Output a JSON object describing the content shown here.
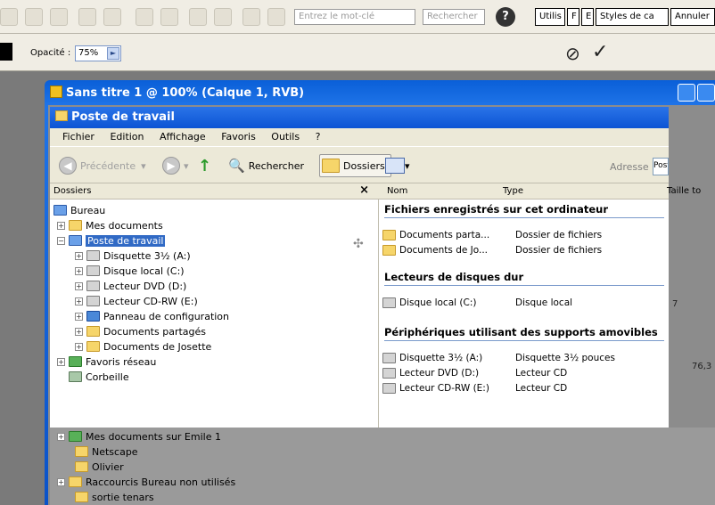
{
  "ps_toolbar": {
    "search_placeholder": "Entrez le mot-clé",
    "search_button": "Rechercher",
    "tabs": [
      "Utilis",
      "F",
      "E",
      "Styles de ca",
      "Annuler"
    ]
  },
  "ps_options": {
    "opacity_label": "Opacité :",
    "opacity_value": "75%",
    "cancel_symbol": "⊘",
    "commit_symbol": "✓"
  },
  "document": {
    "title": "Sans titre 1 @ 100% (Calque 1, RVB)"
  },
  "explorer": {
    "title": "Poste de travail",
    "menu": [
      "Fichier",
      "Edition",
      "Affichage",
      "Favoris",
      "Outils",
      "?"
    ],
    "toolbar": {
      "back": "Précédente",
      "search": "Rechercher",
      "folders": "Dossiers",
      "address_label": "Adresse",
      "address_value": "Poste de travail"
    },
    "left_header": "Dossiers",
    "left_close": "×",
    "columns": {
      "name": "Nom",
      "type": "Type",
      "size": "Taille to"
    },
    "tree": [
      {
        "label": "Bureau"
      },
      {
        "label": "Mes documents"
      },
      {
        "label": "Poste de travail"
      },
      {
        "label": "Disquette 3½ (A:)"
      },
      {
        "label": "Disque local (C:)"
      },
      {
        "label": "Lecteur DVD (D:)"
      },
      {
        "label": "Lecteur CD-RW (E:)"
      },
      {
        "label": "Panneau de configuration"
      },
      {
        "label": "Documents partagés"
      },
      {
        "label": "Documents de Josette"
      },
      {
        "label": "Favoris réseau"
      },
      {
        "label": "Corbeille"
      }
    ],
    "groups": [
      {
        "title": "Fichiers enregistrés sur cet ordinateur",
        "rows": [
          {
            "name": "Documents parta...",
            "type": "Dossier de fichiers"
          },
          {
            "name": "Documents de Jo...",
            "type": "Dossier de fichiers"
          }
        ]
      },
      {
        "title": "Lecteurs de disques dur",
        "rows": [
          {
            "name": "Disque local (C:)",
            "type": "Disque local"
          }
        ]
      },
      {
        "title": "Périphériques utilisant des supports amovibles",
        "rows": [
          {
            "name": "Disquette 3½ (A:)",
            "type": "Disquette 3½ pouces"
          },
          {
            "name": "Lecteur DVD (D:)",
            "type": "Lecteur CD"
          },
          {
            "name": "Lecteur CD-RW (E:)",
            "type": "Lecteur CD"
          }
        ]
      }
    ],
    "beyond_tree": [
      {
        "label": "Mes documents sur Emile 1"
      },
      {
        "label": "Netscape"
      },
      {
        "label": "Olivier"
      },
      {
        "label": "Raccourcis Bureau non utilisés"
      },
      {
        "label": "sortie tenars"
      }
    ],
    "right_ext": {
      "num1": "7",
      "num2": "76,3"
    }
  }
}
